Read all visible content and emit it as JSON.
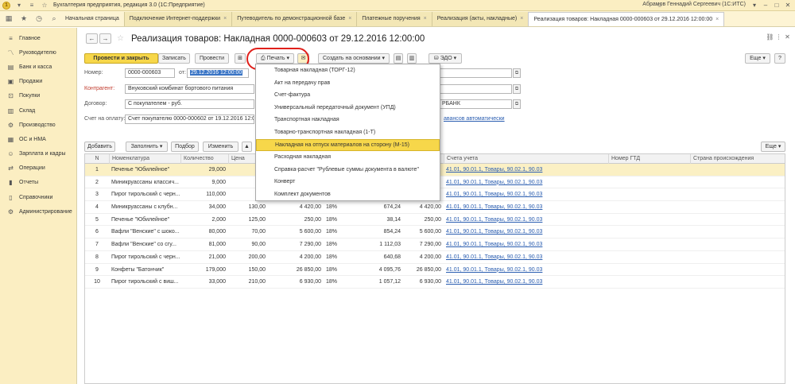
{
  "app": {
    "title": "Бухгалтерия предприятия, редакция 3.0  (1С:Предприятие)",
    "user": "Абрамов Геннадий Сергеевич (1С:ИТС)"
  },
  "tabs": [
    {
      "label": "Начальная страница",
      "active": false
    },
    {
      "label": "Подключение Интернет-поддержки",
      "active": false
    },
    {
      "label": "Путеводитель по демонстрационной базе",
      "active": false
    },
    {
      "label": "Платежные поручения",
      "active": false
    },
    {
      "label": "Реализация (акты, накладные)",
      "active": false
    },
    {
      "label": "Реализация товаров: Накладная 0000-000603 от 29.12.2016 12:00:00",
      "active": true
    }
  ],
  "sidebar": {
    "items": [
      {
        "label": "Главное",
        "icon": "menu-icon"
      },
      {
        "label": "Руководителю",
        "icon": "chart-icon"
      },
      {
        "label": "Банк и касса",
        "icon": "bank-icon"
      },
      {
        "label": "Продажи",
        "icon": "sales-icon"
      },
      {
        "label": "Покупки",
        "icon": "cart-icon"
      },
      {
        "label": "Склад",
        "icon": "warehouse-icon"
      },
      {
        "label": "Производство",
        "icon": "factory-icon"
      },
      {
        "label": "ОС и НМА",
        "icon": "assets-icon"
      },
      {
        "label": "Зарплата и кадры",
        "icon": "people-icon"
      },
      {
        "label": "Операции",
        "icon": "operations-icon"
      },
      {
        "label": "Отчеты",
        "icon": "reports-icon"
      },
      {
        "label": "Справочники",
        "icon": "book-icon"
      },
      {
        "label": "Администрирование",
        "icon": "gear-icon"
      }
    ]
  },
  "document": {
    "title": "Реализация товаров: Накладная 0000-000603 от 29.12.2016 12:00:00"
  },
  "toolbar": {
    "post_close": "Провести и закрыть",
    "save": "Записать",
    "post": "Провести",
    "print": "Печать",
    "create_based": "Создать на основании",
    "edo": "ЭДО",
    "more": "Еще"
  },
  "form": {
    "number_label": "Номер:",
    "number_value": "0000-000603",
    "date_label": "от:",
    "date_value": "29.12.2016 12:00:00",
    "counterparty_label": "Контрагент:",
    "counterparty_value": "Внуковский комбинат бортового питания",
    "contract_label": "Договор:",
    "contract_value": "С покупателем - руб.",
    "invoice_label": "Счет на оплату:",
    "invoice_value": "Счет покупателю 0000-000602 от 19.12.2016 12:00:00",
    "bank_value_tail": "РБАНК",
    "advance_link": "авансов автоматически"
  },
  "table_toolbar": {
    "add": "Добавить",
    "fill": "Заполнить",
    "pick": "Подбор",
    "change": "Изменить",
    "more": "Еще"
  },
  "table": {
    "headers": {
      "n": "N",
      "item": "Номенклатура",
      "qty": "Количество",
      "price": "Цена",
      "account": "Счета учета",
      "gtd": "Номер ГТД",
      "country": "Страна происхождения"
    },
    "rows": [
      {
        "n": "1",
        "item": "Печенье \"Юбилейное\"",
        "qty": "29,000",
        "price": "",
        "sum": "",
        "vat": "",
        "vat_sum": "",
        "total": "",
        "account": "41.01, 90.01.1, Товары, 90.02.1, 90.03"
      },
      {
        "n": "2",
        "item": "Миникруассаны классич...",
        "qty": "9,000",
        "price": "",
        "sum": "",
        "vat": "",
        "vat_sum": "",
        "total": "",
        "account": "41.01, 90.01.1, Товары, 90.02.1, 90.03"
      },
      {
        "n": "3",
        "item": "Пирог тирольский с черн...",
        "qty": "110,000",
        "price": "",
        "sum": "",
        "vat": "",
        "vat_sum": "",
        "total": "",
        "account": "41.01, 90.01.1, Товары, 90.02.1, 90.03"
      },
      {
        "n": "4",
        "item": "Миникруассаны с клубн...",
        "qty": "34,000",
        "price": "130,00",
        "sum": "4 420,00",
        "vat": "18%",
        "vat_sum": "674,24",
        "total": "4 420,00",
        "account": "41.01, 90.01.1, Товары, 90.02.1, 90.03"
      },
      {
        "n": "5",
        "item": "Печенье \"Юбилейное\"",
        "qty": "2,000",
        "price": "125,00",
        "sum": "250,00",
        "vat": "18%",
        "vat_sum": "38,14",
        "total": "250,00",
        "account": "41.01, 90.01.1, Товары, 90.02.1, 90.03"
      },
      {
        "n": "6",
        "item": "Вафли \"Венские\" с шоко...",
        "qty": "80,000",
        "price": "70,00",
        "sum": "5 600,00",
        "vat": "18%",
        "vat_sum": "854,24",
        "total": "5 600,00",
        "account": "41.01, 90.01.1, Товары, 90.02.1, 90.03"
      },
      {
        "n": "7",
        "item": "Вафли \"Венские\" со сгу...",
        "qty": "81,000",
        "price": "90,00",
        "sum": "7 290,00",
        "vat": "18%",
        "vat_sum": "1 112,03",
        "total": "7 290,00",
        "account": "41.01, 90.01.1, Товары, 90.02.1, 90.03"
      },
      {
        "n": "8",
        "item": "Пирог тирольский с черн...",
        "qty": "21,000",
        "price": "200,00",
        "sum": "4 200,00",
        "vat": "18%",
        "vat_sum": "640,68",
        "total": "4 200,00",
        "account": "41.01, 90.01.1, Товары, 90.02.1, 90.03"
      },
      {
        "n": "9",
        "item": "Конфеты \"Батончик\"",
        "qty": "179,000",
        "price": "150,00",
        "sum": "26 850,00",
        "vat": "18%",
        "vat_sum": "4 095,76",
        "total": "26 850,00",
        "account": "41.01, 90.01.1, Товары, 90.02.1, 90.03"
      },
      {
        "n": "10",
        "item": "Пирог тирольский с виш...",
        "qty": "33,000",
        "price": "210,00",
        "sum": "6 930,00",
        "vat": "18%",
        "vat_sum": "1 057,12",
        "total": "6 930,00",
        "account": "41.01, 90.01.1, Товары, 90.02.1, 90.03"
      }
    ]
  },
  "print_menu": {
    "items": [
      "Товарная накладная (ТОРГ-12)",
      "Акт на передачу прав",
      "Счет-фактура",
      "Универсальный передаточный документ (УПД)",
      "Транспортная накладная",
      "Товарно-транспортная накладная (1-Т)",
      "Накладная на отпуск материалов на сторону (М-15)",
      "Расходная накладная",
      "Справка-расчет \"Рублевые суммы документа в валюте\"",
      "Конверт",
      "Комплект документов"
    ],
    "highlighted_index": 6
  },
  "colors": {
    "accent_yellow": "#f7d74a",
    "sidebar_bg": "#fbeec2",
    "link_blue": "#2a5db0",
    "highlight_red": "#e0201b"
  }
}
